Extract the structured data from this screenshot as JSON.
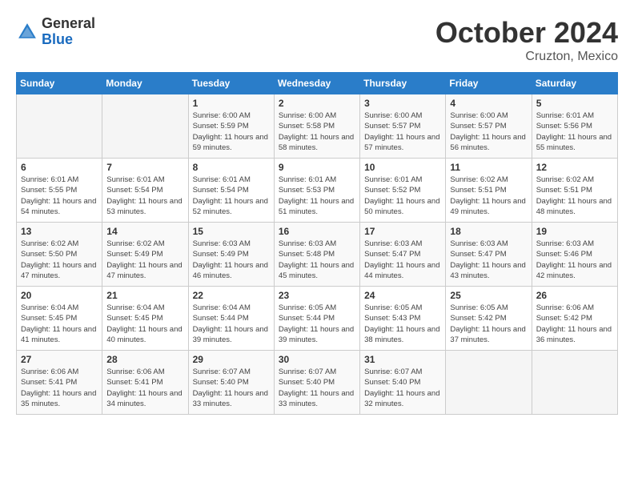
{
  "header": {
    "logo_general": "General",
    "logo_blue": "Blue",
    "month": "October 2024",
    "location": "Cruzton, Mexico"
  },
  "days_of_week": [
    "Sunday",
    "Monday",
    "Tuesday",
    "Wednesday",
    "Thursday",
    "Friday",
    "Saturday"
  ],
  "weeks": [
    [
      {
        "day": "",
        "sunrise": "",
        "sunset": "",
        "daylight": ""
      },
      {
        "day": "",
        "sunrise": "",
        "sunset": "",
        "daylight": ""
      },
      {
        "day": "1",
        "sunrise": "Sunrise: 6:00 AM",
        "sunset": "Sunset: 5:59 PM",
        "daylight": "Daylight: 11 hours and 59 minutes."
      },
      {
        "day": "2",
        "sunrise": "Sunrise: 6:00 AM",
        "sunset": "Sunset: 5:58 PM",
        "daylight": "Daylight: 11 hours and 58 minutes."
      },
      {
        "day": "3",
        "sunrise": "Sunrise: 6:00 AM",
        "sunset": "Sunset: 5:57 PM",
        "daylight": "Daylight: 11 hours and 57 minutes."
      },
      {
        "day": "4",
        "sunrise": "Sunrise: 6:00 AM",
        "sunset": "Sunset: 5:57 PM",
        "daylight": "Daylight: 11 hours and 56 minutes."
      },
      {
        "day": "5",
        "sunrise": "Sunrise: 6:01 AM",
        "sunset": "Sunset: 5:56 PM",
        "daylight": "Daylight: 11 hours and 55 minutes."
      }
    ],
    [
      {
        "day": "6",
        "sunrise": "Sunrise: 6:01 AM",
        "sunset": "Sunset: 5:55 PM",
        "daylight": "Daylight: 11 hours and 54 minutes."
      },
      {
        "day": "7",
        "sunrise": "Sunrise: 6:01 AM",
        "sunset": "Sunset: 5:54 PM",
        "daylight": "Daylight: 11 hours and 53 minutes."
      },
      {
        "day": "8",
        "sunrise": "Sunrise: 6:01 AM",
        "sunset": "Sunset: 5:54 PM",
        "daylight": "Daylight: 11 hours and 52 minutes."
      },
      {
        "day": "9",
        "sunrise": "Sunrise: 6:01 AM",
        "sunset": "Sunset: 5:53 PM",
        "daylight": "Daylight: 11 hours and 51 minutes."
      },
      {
        "day": "10",
        "sunrise": "Sunrise: 6:01 AM",
        "sunset": "Sunset: 5:52 PM",
        "daylight": "Daylight: 11 hours and 50 minutes."
      },
      {
        "day": "11",
        "sunrise": "Sunrise: 6:02 AM",
        "sunset": "Sunset: 5:51 PM",
        "daylight": "Daylight: 11 hours and 49 minutes."
      },
      {
        "day": "12",
        "sunrise": "Sunrise: 6:02 AM",
        "sunset": "Sunset: 5:51 PM",
        "daylight": "Daylight: 11 hours and 48 minutes."
      }
    ],
    [
      {
        "day": "13",
        "sunrise": "Sunrise: 6:02 AM",
        "sunset": "Sunset: 5:50 PM",
        "daylight": "Daylight: 11 hours and 47 minutes."
      },
      {
        "day": "14",
        "sunrise": "Sunrise: 6:02 AM",
        "sunset": "Sunset: 5:49 PM",
        "daylight": "Daylight: 11 hours and 47 minutes."
      },
      {
        "day": "15",
        "sunrise": "Sunrise: 6:03 AM",
        "sunset": "Sunset: 5:49 PM",
        "daylight": "Daylight: 11 hours and 46 minutes."
      },
      {
        "day": "16",
        "sunrise": "Sunrise: 6:03 AM",
        "sunset": "Sunset: 5:48 PM",
        "daylight": "Daylight: 11 hours and 45 minutes."
      },
      {
        "day": "17",
        "sunrise": "Sunrise: 6:03 AM",
        "sunset": "Sunset: 5:47 PM",
        "daylight": "Daylight: 11 hours and 44 minutes."
      },
      {
        "day": "18",
        "sunrise": "Sunrise: 6:03 AM",
        "sunset": "Sunset: 5:47 PM",
        "daylight": "Daylight: 11 hours and 43 minutes."
      },
      {
        "day": "19",
        "sunrise": "Sunrise: 6:03 AM",
        "sunset": "Sunset: 5:46 PM",
        "daylight": "Daylight: 11 hours and 42 minutes."
      }
    ],
    [
      {
        "day": "20",
        "sunrise": "Sunrise: 6:04 AM",
        "sunset": "Sunset: 5:45 PM",
        "daylight": "Daylight: 11 hours and 41 minutes."
      },
      {
        "day": "21",
        "sunrise": "Sunrise: 6:04 AM",
        "sunset": "Sunset: 5:45 PM",
        "daylight": "Daylight: 11 hours and 40 minutes."
      },
      {
        "day": "22",
        "sunrise": "Sunrise: 6:04 AM",
        "sunset": "Sunset: 5:44 PM",
        "daylight": "Daylight: 11 hours and 39 minutes."
      },
      {
        "day": "23",
        "sunrise": "Sunrise: 6:05 AM",
        "sunset": "Sunset: 5:44 PM",
        "daylight": "Daylight: 11 hours and 39 minutes."
      },
      {
        "day": "24",
        "sunrise": "Sunrise: 6:05 AM",
        "sunset": "Sunset: 5:43 PM",
        "daylight": "Daylight: 11 hours and 38 minutes."
      },
      {
        "day": "25",
        "sunrise": "Sunrise: 6:05 AM",
        "sunset": "Sunset: 5:42 PM",
        "daylight": "Daylight: 11 hours and 37 minutes."
      },
      {
        "day": "26",
        "sunrise": "Sunrise: 6:06 AM",
        "sunset": "Sunset: 5:42 PM",
        "daylight": "Daylight: 11 hours and 36 minutes."
      }
    ],
    [
      {
        "day": "27",
        "sunrise": "Sunrise: 6:06 AM",
        "sunset": "Sunset: 5:41 PM",
        "daylight": "Daylight: 11 hours and 35 minutes."
      },
      {
        "day": "28",
        "sunrise": "Sunrise: 6:06 AM",
        "sunset": "Sunset: 5:41 PM",
        "daylight": "Daylight: 11 hours and 34 minutes."
      },
      {
        "day": "29",
        "sunrise": "Sunrise: 6:07 AM",
        "sunset": "Sunset: 5:40 PM",
        "daylight": "Daylight: 11 hours and 33 minutes."
      },
      {
        "day": "30",
        "sunrise": "Sunrise: 6:07 AM",
        "sunset": "Sunset: 5:40 PM",
        "daylight": "Daylight: 11 hours and 33 minutes."
      },
      {
        "day": "31",
        "sunrise": "Sunrise: 6:07 AM",
        "sunset": "Sunset: 5:40 PM",
        "daylight": "Daylight: 11 hours and 32 minutes."
      },
      {
        "day": "",
        "sunrise": "",
        "sunset": "",
        "daylight": ""
      },
      {
        "day": "",
        "sunrise": "",
        "sunset": "",
        "daylight": ""
      }
    ]
  ]
}
